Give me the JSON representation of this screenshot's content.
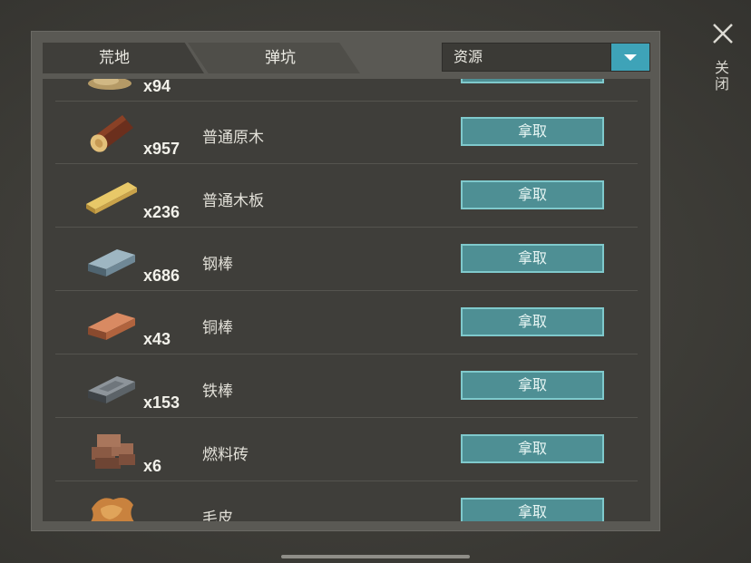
{
  "tabs": [
    {
      "label": "荒地"
    },
    {
      "label": "弹坑"
    }
  ],
  "filter": {
    "selected": "资源"
  },
  "close": {
    "label": "关闭"
  },
  "take_label": "拿取",
  "items": [
    {
      "qty": "x94",
      "name": "",
      "icon": "sawdust-icon"
    },
    {
      "qty": "x957",
      "name": "普通原木",
      "icon": "log-icon"
    },
    {
      "qty": "x236",
      "name": "普通木板",
      "icon": "plank-icon"
    },
    {
      "qty": "x686",
      "name": "钢棒",
      "icon": "steel-bar-icon"
    },
    {
      "qty": "x43",
      "name": "铜棒",
      "icon": "copper-bar-icon"
    },
    {
      "qty": "x153",
      "name": "铁棒",
      "icon": "iron-bar-icon"
    },
    {
      "qty": "x6",
      "name": "燃料砖",
      "icon": "fuel-brick-icon"
    },
    {
      "qty": "",
      "name": "毛皮",
      "icon": "fur-icon"
    }
  ]
}
